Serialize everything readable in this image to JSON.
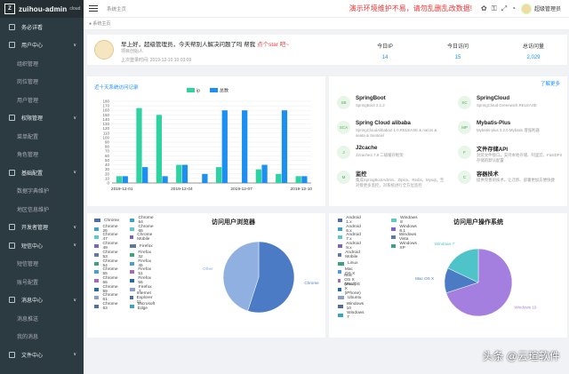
{
  "app": {
    "logo_letter": "Z",
    "title": "zuihou-admin",
    "suffix": "cloud"
  },
  "sidebar": [
    {
      "label": "务必详看",
      "type": "top",
      "arrow": ""
    },
    {
      "label": "用户中心",
      "type": "top",
      "arrow": "∨"
    },
    {
      "label": "组织管理",
      "type": "sub"
    },
    {
      "label": "岗位管理",
      "type": "sub"
    },
    {
      "label": "用户管理",
      "type": "sub"
    },
    {
      "label": "权限管理",
      "type": "top",
      "arrow": "∨"
    },
    {
      "label": "菜单配置",
      "type": "sub"
    },
    {
      "label": "角色管理",
      "type": "sub"
    },
    {
      "label": "基础配置",
      "type": "top",
      "arrow": "∨"
    },
    {
      "label": "数据字典维护",
      "type": "sub"
    },
    {
      "label": "地区信息维护",
      "type": "sub"
    },
    {
      "label": "开发者管理",
      "type": "top",
      "arrow": "∨"
    },
    {
      "label": "短信中心",
      "type": "top",
      "arrow": "∨"
    },
    {
      "label": "短信管理",
      "type": "sub"
    },
    {
      "label": "账号配置",
      "type": "sub"
    },
    {
      "label": "消息中心",
      "type": "top",
      "arrow": "∨"
    },
    {
      "label": "消息推送",
      "type": "sub"
    },
    {
      "label": "我的消息",
      "type": "sub"
    },
    {
      "label": "文件中心",
      "type": "top",
      "arrow": "∨"
    }
  ],
  "topbar": {
    "tab": "系统主页",
    "notice": "演示环境维护不易，请勿乱删乱改数据!",
    "user": "超级管理员"
  },
  "tabs": {
    "home": "● 系统主页"
  },
  "welcome": {
    "greeting": "早上好，超级管理员，今天帮别人解决问题了吗 帮我",
    "star": "点个star 吧~",
    "dept": "项目创始人",
    "last_login": "上次登录时间:  2019-12-10 10:03:09"
  },
  "stats": [
    {
      "label": "今日IP",
      "value": "14"
    },
    {
      "label": "今日访问",
      "value": "15"
    },
    {
      "label": "总访问量",
      "value": "2,029"
    }
  ],
  "visits": {
    "title": "近十天系统访问记录"
  },
  "projects": {
    "more": "了解更多",
    "items": [
      {
        "abbr": "SB",
        "name": "SpringBoot",
        "desc": "SpringBoot 2.1.2"
      },
      {
        "abbr": "SC",
        "name": "SpringCloud",
        "desc": "SpringCloud Greenwich.RELEASE"
      },
      {
        "abbr": "SCA",
        "name": "Spring Cloud alibaba",
        "desc": "SpringCloudAlibaba2.1.0.RELEASE & nacos & seata & Sentinel"
      },
      {
        "abbr": "MP",
        "name": "Mybatis-Plus",
        "desc": "Mybatis-plus 3.2.0    Mybatis 增强利器"
      },
      {
        "abbr": "J",
        "name": "J2cache",
        "desc": "J2cache2.7.8   二级缓存框架"
      },
      {
        "abbr": "F",
        "name": "文件存储API",
        "desc": "封装文件接口，支持本地存储、阿里云、FastDFS存储的默认配置"
      },
      {
        "abbr": "M",
        "name": "监控",
        "desc": "集成SpringBootAdmin、Zipkin、Redis、Mysql，至对接更多监控，对系统进行全方位监控"
      },
      {
        "abbr": "C",
        "name": "容器技术",
        "desc": "提供完善的技术，让迁移、部署更加方便快捷"
      }
    ]
  },
  "watermark": "头条 @云瑄软件",
  "colors": {
    "ip": "#2fd3a2",
    "total": "#1d8ff1"
  },
  "chart_data": [
    {
      "type": "bar",
      "title": "近十天系统访问记录",
      "categories": [
        "2019-12-01",
        "2019-12-02",
        "2019-12-03",
        "2019-12-04",
        "2019-12-05",
        "2019-12-06",
        "2019-12-07",
        "2019-12-08",
        "2019-12-09",
        "2019-12-10"
      ],
      "tick_labels": [
        "2019-12-01",
        "2019-12-04",
        "2019-12-07",
        "2019-12-10"
      ],
      "series": [
        {
          "name": "ip",
          "values": [
            15,
            165,
            150,
            40,
            0,
            35,
            0,
            30,
            20,
            15
          ]
        },
        {
          "name": "总数",
          "values": [
            15,
            35,
            15,
            40,
            20,
            160,
            160,
            40,
            160,
            15
          ]
        }
      ],
      "ylim": [
        0,
        180
      ],
      "yticks": [
        0,
        10,
        20,
        30,
        40,
        50,
        60,
        70,
        80,
        90,
        100,
        110,
        120,
        130,
        140,
        150,
        160,
        170,
        180
      ],
      "legend": "top"
    },
    {
      "type": "pie",
      "title": "访问用户浏览器",
      "legend": [
        "Chrome",
        "Chrome 26",
        "Chrome 47",
        "Chrome 49",
        "Chrome 53",
        "Chrome 54",
        "Chrome 55",
        "Chrome 56",
        "Chrome 59",
        "Chrome 61",
        "Chrome 63",
        "Chrome 64",
        "Chrome 65",
        "Chrome Mobile",
        "Firefox",
        "Firefox 32",
        "Firefox 45",
        "Firefox 51",
        "Firefox 56",
        "Firefox 7",
        "Internet Explorer 11",
        "Microsoft Edge"
      ],
      "slices": [
        {
          "label": "Chrome",
          "value": 55
        },
        {
          "label": "Other",
          "value": 45
        }
      ]
    },
    {
      "type": "pie",
      "title": "访问用户操作系统",
      "legend": [
        "Android 1.x",
        "Android 6.x",
        "Android 7.x",
        "Android 8.x",
        "Android Mobile",
        "Linux",
        "Mac OS X",
        "Mac OS X (iPad)",
        "Mac OS X (iPhone)",
        "Ubuntu",
        "Windows 10",
        "Windows 7",
        "Windows 8",
        "Windows 8.1",
        "Windows Vista",
        "Windows XP"
      ],
      "slices": [
        {
          "label": "Windows 10",
          "value": 70
        },
        {
          "label": "Mac OS X",
          "value": 12
        },
        {
          "label": "Windows 7",
          "value": 18
        }
      ]
    }
  ]
}
